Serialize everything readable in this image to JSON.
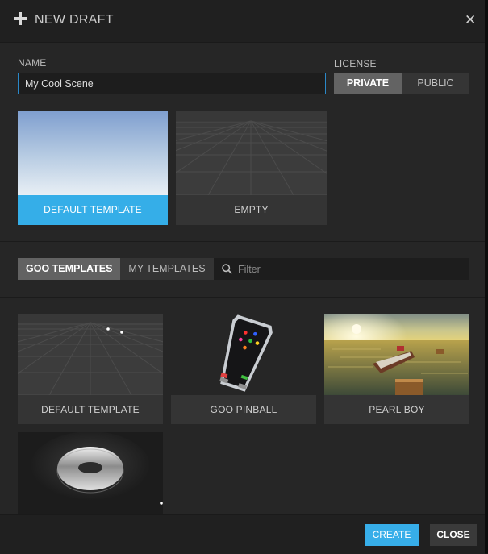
{
  "dialog": {
    "title": "NEW DRAFT",
    "close_icon": "close-icon"
  },
  "form": {
    "name_label": "NAME",
    "name_value": "My Cool Scene",
    "license_label": "LICENSE",
    "license_options": [
      "PRIVATE",
      "PUBLIC"
    ],
    "license_selected": "PRIVATE"
  },
  "base_templates": [
    {
      "label": "DEFAULT TEMPLATE",
      "selected": true
    },
    {
      "label": "EMPTY",
      "selected": false
    }
  ],
  "template_tabs": {
    "items": [
      "GOO TEMPLATES",
      "MY TEMPLATES"
    ],
    "active": "GOO TEMPLATES"
  },
  "filter": {
    "placeholder": "Filter",
    "icon": "search-icon"
  },
  "gallery": [
    {
      "label": "DEFAULT TEMPLATE"
    },
    {
      "label": "GOO PINBALL"
    },
    {
      "label": "PEARL BOY"
    },
    {
      "label": ""
    }
  ],
  "footer": {
    "create_label": "CREATE",
    "close_label": "CLOSE"
  },
  "colors": {
    "accent": "#35aee8",
    "dialog_bg": "#262626",
    "tile_bg": "#343434"
  }
}
